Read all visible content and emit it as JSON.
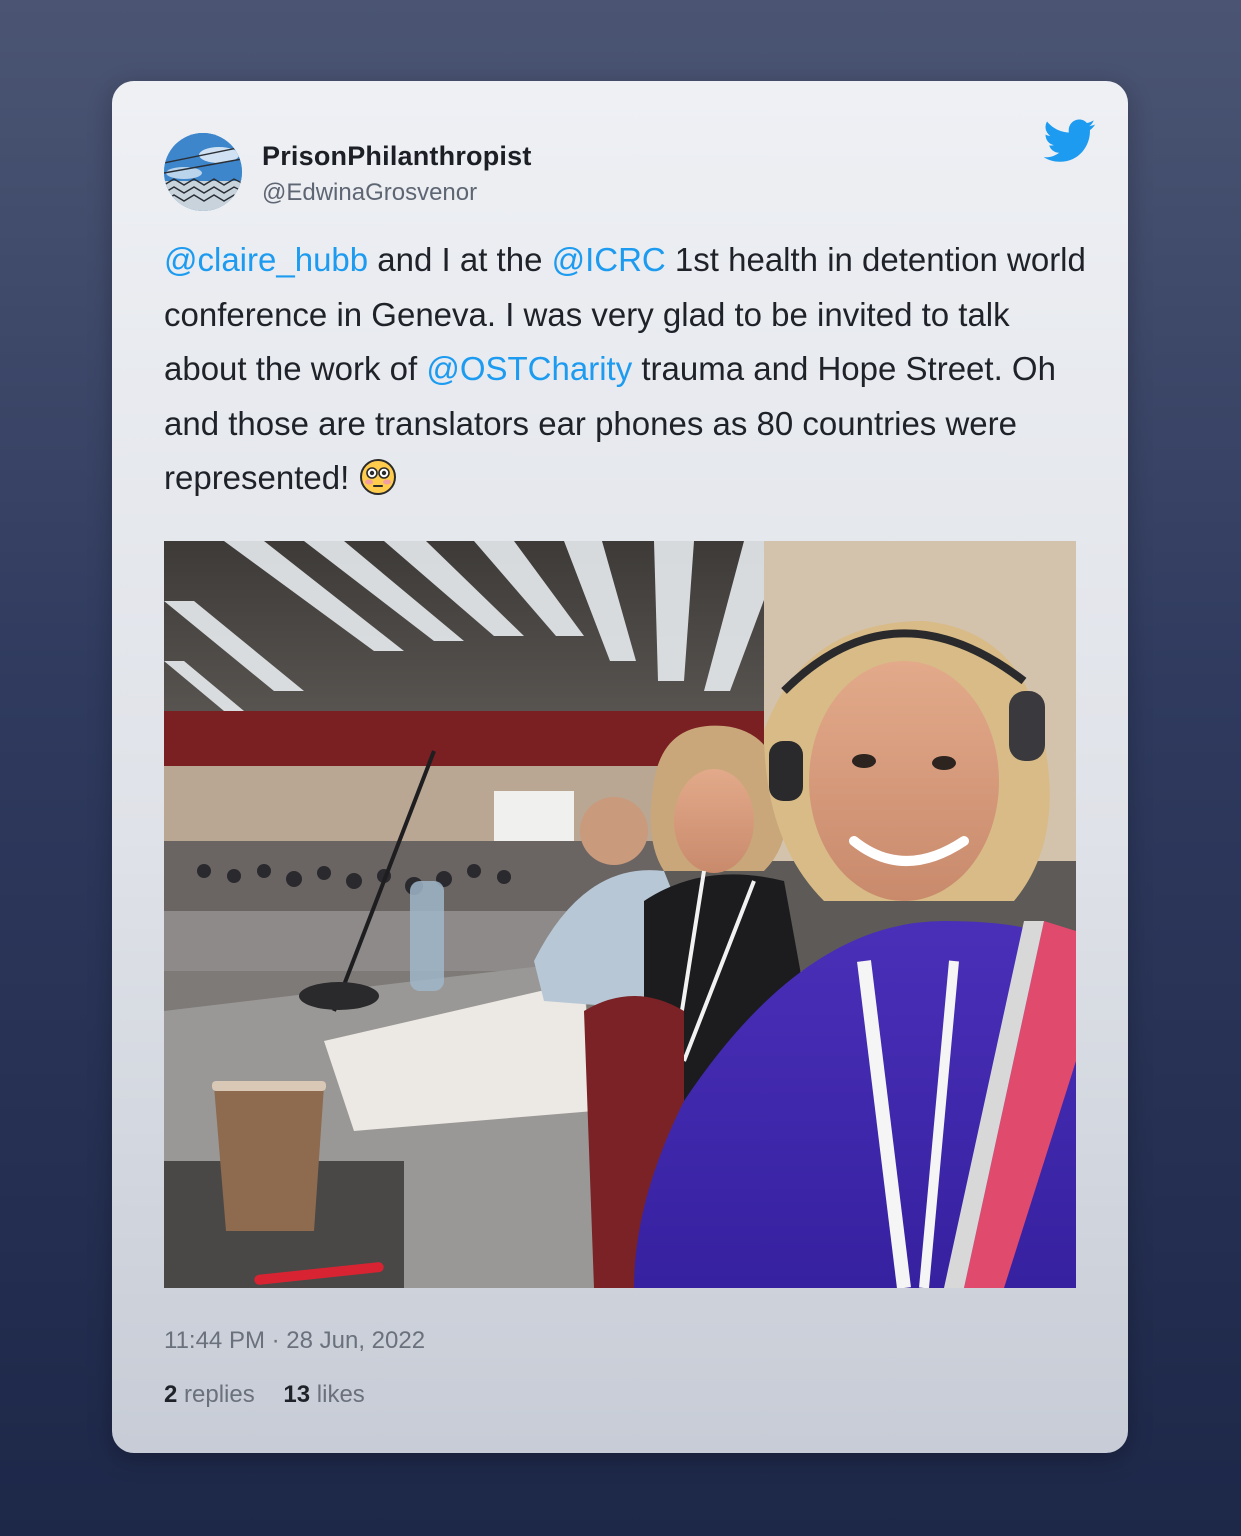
{
  "tweet": {
    "display_name": "PrisonPhilanthropist",
    "handle": "@EdwinaGrosvenor",
    "text_segments": [
      {
        "text": "@claire_hubb",
        "type": "mention"
      },
      {
        "text": " and I at the ",
        "type": "text"
      },
      {
        "text": "@ICRC",
        "type": "mention"
      },
      {
        "text": " 1st health in detention world conference in Geneva. I was very glad to be invited to talk about the work of ",
        "type": "text"
      },
      {
        "text": "@OSTCharity",
        "type": "mention"
      },
      {
        "text": " trauma and Hope Street. Oh and those are translators ear phones as 80 countries were represented!",
        "type": "text"
      }
    ],
    "emoji": "flushed-face-emoji",
    "photo": "conference-selfie-photo",
    "timestamp": "11:44 PM · 28 Jun, 2022",
    "replies_count": "2",
    "replies_label": "replies",
    "likes_count": "13",
    "likes_label": "likes"
  },
  "colors": {
    "mention": "#1d9bf0",
    "twitter_blue": "#1d9bf0",
    "text": "#1f2329",
    "muted": "#6b717c"
  },
  "icons": {
    "brand": "twitter-bird-icon"
  }
}
